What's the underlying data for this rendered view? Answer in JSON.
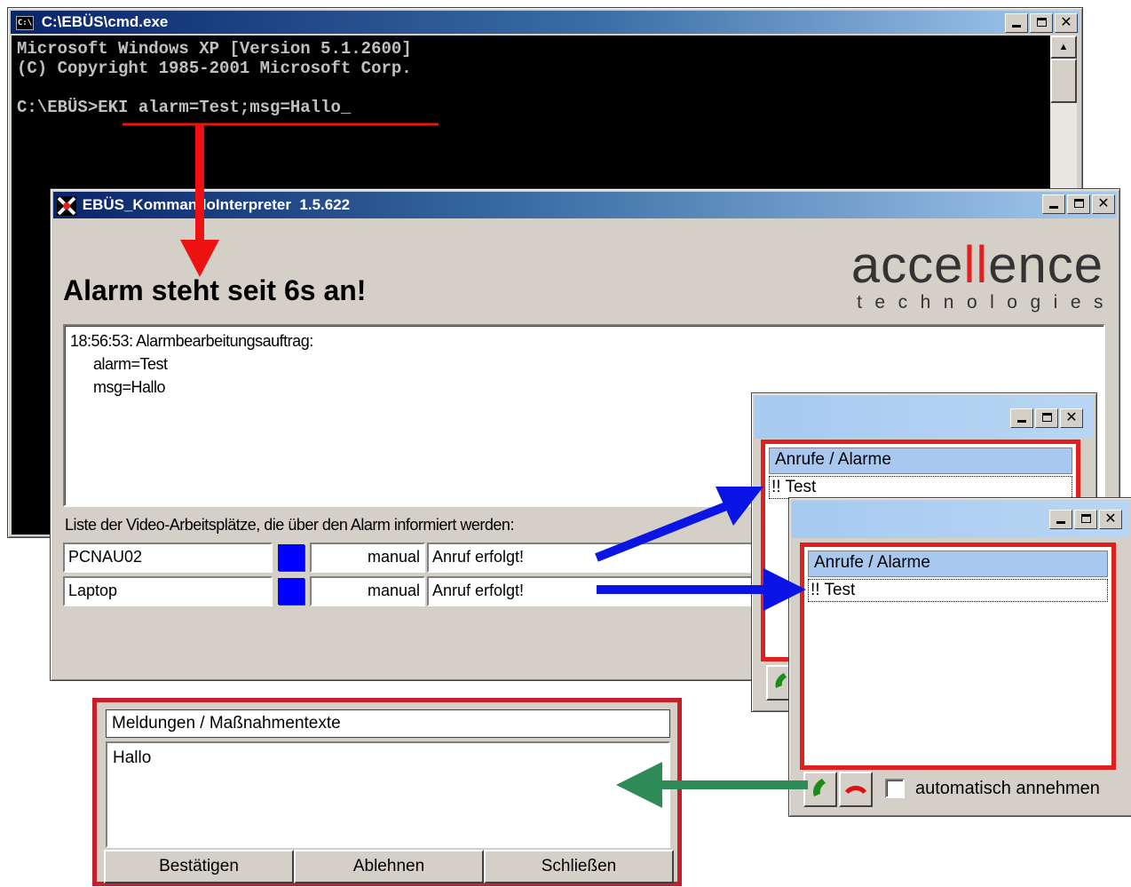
{
  "cmd": {
    "title": "C:\\EBÜS\\cmd.exe",
    "line1": "Microsoft Windows XP [Version 5.1.2600]",
    "line2": "(C) Copyright 1985-2001 Microsoft Corp.",
    "prompt": "C:\\EBÜS>",
    "command": "EKI alarm=Test;msg=Hallo",
    "cursor": "_"
  },
  "eki": {
    "title_a": "EBÜS_Kom",
    "title_b": "mandoInterpreter  1.5.622",
    "heading": "Alarm steht seit 6s an!",
    "logo": {
      "pre": "acce",
      "mid": "ll",
      "post": "ence",
      "sub": "technologies"
    },
    "log": [
      "18:56:53: Alarmbearbeitungsauftrag:",
      "alarm=Test",
      "msg=Hallo"
    ],
    "list_label": "Liste der Video-Arbeitsplätze, die über den Alarm informiert werden:",
    "rows": [
      {
        "name": "PCNAU02",
        "mode": "manual",
        "status": "Anruf erfolgt!"
      },
      {
        "name": "Laptop",
        "mode": "manual",
        "status": "Anruf erfolgt!"
      }
    ]
  },
  "popup1": {
    "header": "Anrufe / Alarme",
    "item": "!! Test"
  },
  "popup2": {
    "header": "Anrufe / Alarme",
    "item": "!! Test",
    "auto_accept_label": "automatisch annehmen",
    "auto_accept_checked": false
  },
  "messages": {
    "header": "Meldungen / Maßnahmentexte",
    "text": "Hallo",
    "buttons": [
      "Bestätigen",
      "Ablehnen",
      "Schließen"
    ]
  },
  "colors": {
    "arrow_red": "#ee1111",
    "arrow_blue": "#0a14e6",
    "arrow_green": "#2e8b57",
    "status_blue": "#0000ff",
    "frame_red": "#e02020",
    "logo_red": "#e61e1e"
  }
}
